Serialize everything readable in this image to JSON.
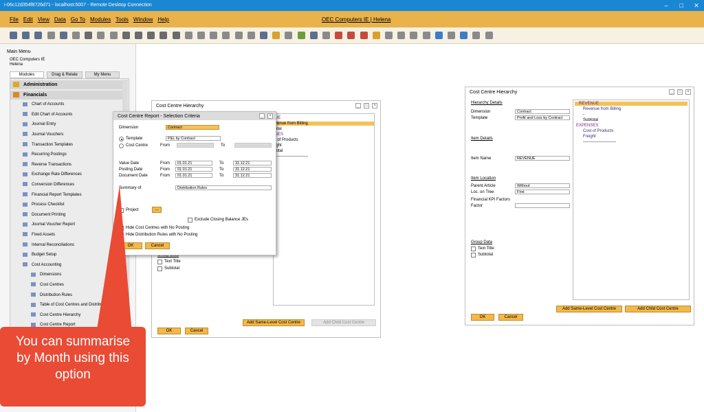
{
  "rdp": {
    "title": "i-06c12d354f8726d71 - localhost:5007 - Remote Desktop Connection"
  },
  "app": {
    "title": "OEC Computers IE | Helena",
    "menu": [
      "File",
      "Edit",
      "View",
      "Data",
      "Go To",
      "Modules",
      "Tools",
      "Window",
      "Help"
    ]
  },
  "main_menu": {
    "title": "Main Menu",
    "company": "OEC Computers IE",
    "user": "Helena",
    "tabs": [
      "Modules",
      "Drag & Relate",
      "My Menu"
    ],
    "items": [
      {
        "label": "Administration",
        "hdr": true
      },
      {
        "label": "Financials",
        "hdr": true
      },
      {
        "label": "Chart of Accounts"
      },
      {
        "label": "Edit Chart of Accounts"
      },
      {
        "label": "Journal Entry"
      },
      {
        "label": "Journal Vouchers"
      },
      {
        "label": "Transaction Templates"
      },
      {
        "label": "Recurring Postings"
      },
      {
        "label": "Reverse Transactions"
      },
      {
        "label": "Exchange Rate Differences"
      },
      {
        "label": "Conversion Differences"
      },
      {
        "label": "Financial Report Templates"
      },
      {
        "label": "Process Checklist"
      },
      {
        "label": "Document Printing"
      },
      {
        "label": "Journal Voucher Report"
      },
      {
        "label": "Fixed Assets"
      },
      {
        "label": "Internal Reconciliations"
      },
      {
        "label": "Budget Setup"
      },
      {
        "label": "Cost Accounting"
      },
      {
        "label": "Dimensions",
        "sub": true
      },
      {
        "label": "Cost Centres",
        "sub": true
      },
      {
        "label": "Distribution Rules",
        "sub": true
      },
      {
        "label": "Table of Cost Centres and Distribution Rules",
        "sub": true
      },
      {
        "label": "Cost Centre Hierarchy",
        "sub": true
      },
      {
        "label": "Cost Centre Report",
        "sub": true
      }
    ]
  },
  "cch_back": {
    "title": "Cost Centre Hierarchy",
    "tree": [
      "UE",
      "venue from Billing",
      "otal",
      "SES",
      "t of Products",
      "ight",
      "total",
      "------------------------"
    ],
    "group_data": "Group Data",
    "text_title": "Text Title",
    "subtotal": "Subtotal",
    "ok": "OK",
    "cancel": "Cancel",
    "add_same": "Add Same-Level Cost Centre",
    "add_child": "Add Child Cost Centre"
  },
  "dialog": {
    "title": "Cost Centre Report - Selection Criteria",
    "dimension_label": "Dimension",
    "dimension_value": "Contract",
    "template_label": "Template",
    "template_value": "P&L by Contract",
    "cost_centre_label": "Cost Centre",
    "from": "From",
    "to": "To",
    "value_date_label": "Value Date",
    "posting_date_label": "Posting Date",
    "document_date_label": "Document Date",
    "value_from": "01.01.21",
    "value_to": "31.12.21",
    "posting_from": "01.01.21",
    "posting_to": "31.12.21",
    "document_from": "01.01.21",
    "document_to": "31.12.21",
    "summary_label": "Summary of",
    "summary_value": "Distribution Rules",
    "project_label": "Project",
    "exclude_label": "Exclude Closing Balance JEs",
    "hide_cc_label": "Hide Cost Centres with No Posting",
    "hide_dr_label": "Hide Distribution Rules with No Posting",
    "ok": "OK",
    "cancel": "Cancel",
    "ellipsis": "..."
  },
  "cch_right": {
    "title": "Cost Centre Hierarchy",
    "hierarchy_details": "Hierarchy Details",
    "dimension_label": "Dimension",
    "dimension_value": "Contract",
    "template_label": "Template",
    "template_value": "Profit and Loss by Contract",
    "item_details": "Item Details",
    "item_name_label": "Item Name",
    "item_name_value": "REVENUE",
    "item_location": "Item Location",
    "parent_label": "Parent Article",
    "parent_value": "Without",
    "loc_label": "Loc. on Tree",
    "loc_value": "First",
    "kpi_label": "Financial KPI Factors",
    "factor_label": "Factor",
    "group_data": "Group Data",
    "text_title": "Text Title",
    "subtotal": "Subtotal",
    "tree": [
      "REVENUE",
      "Revenue from Billing",
      "-",
      "Subtotal",
      "EXPENSES",
      "Cost of Products",
      "Freight",
      "------------------------"
    ],
    "ok": "OK",
    "cancel": "Cancel",
    "add_same": "Add Same-Level Cost Centre",
    "add_child": "Add Child Cost Centre"
  },
  "callout": {
    "text": "You can summarise by Month using this option"
  },
  "colors": {
    "accent": "#e9b24a",
    "callout": "#e94b35",
    "rdp_bar": "#1a87d3"
  }
}
